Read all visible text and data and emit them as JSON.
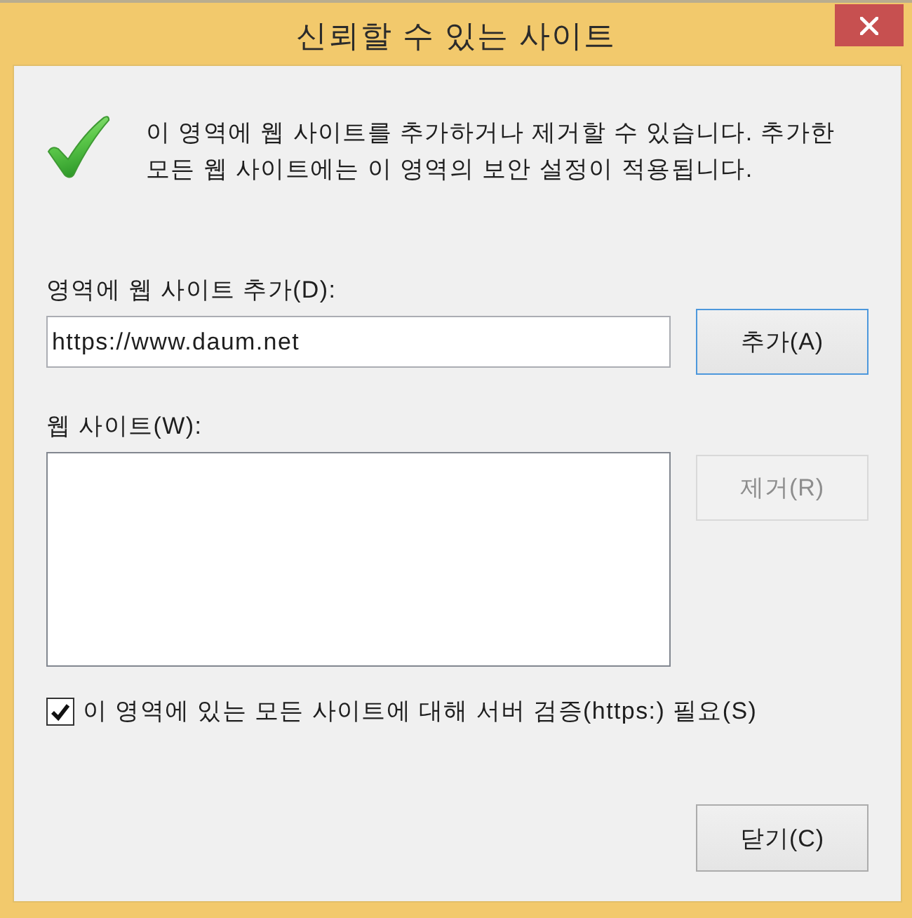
{
  "window": {
    "title": "신뢰할 수 있는 사이트"
  },
  "message": {
    "text": "이 영역에 웹 사이트를 추가하거나 제거할 수 있습니다. 추가한 모든 웹 사이트에는 이 영역의 보안 설정이 적용됩니다."
  },
  "add_field": {
    "label": "영역에 웹 사이트 추가(D):",
    "value": "https://www.daum.net"
  },
  "add_button": {
    "label": "추가(A)",
    "default": true,
    "disabled": false
  },
  "sites_list": {
    "label": "웹 사이트(W):"
  },
  "remove_button": {
    "label": "제거(R)",
    "default": false,
    "disabled": true
  },
  "require_https": {
    "label": "이 영역에 있는 모든 사이트에 대해 서버 검증(https:) 필요(S)",
    "checked": true
  },
  "close_button": {
    "label": "닫기(C)",
    "default": false,
    "disabled": false
  }
}
